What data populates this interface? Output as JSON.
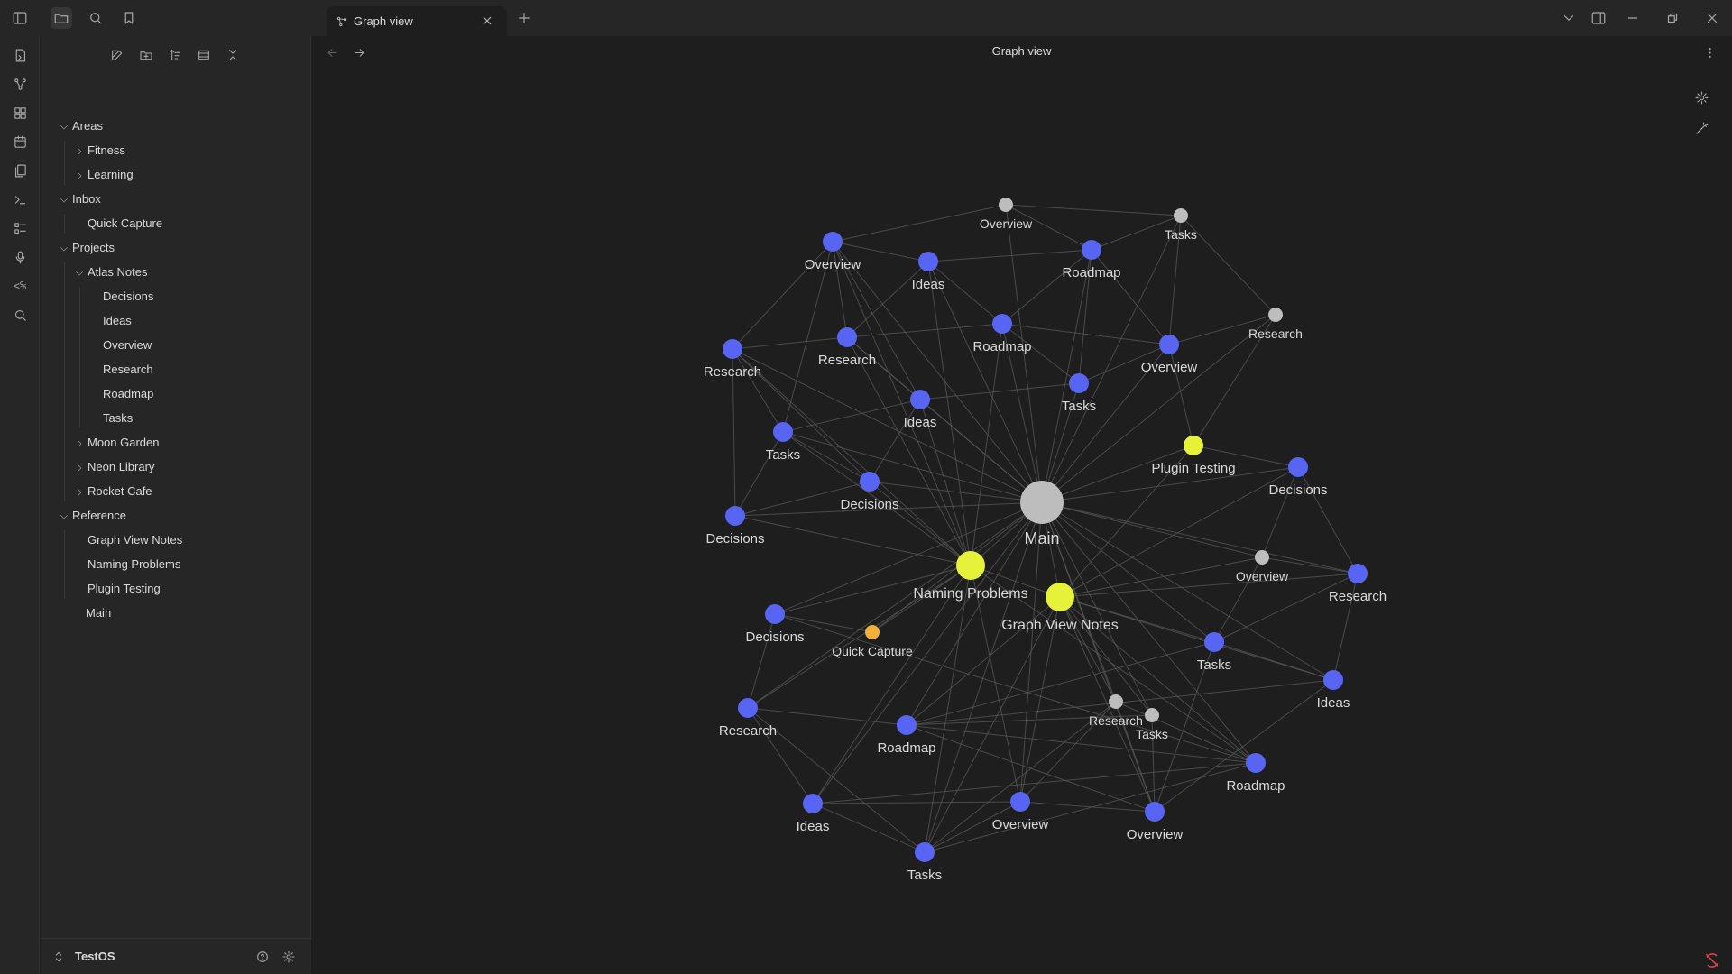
{
  "tab": {
    "title": "Graph view"
  },
  "view": {
    "title": "Graph view"
  },
  "sidebar": {
    "tree": [
      {
        "label": "Areas",
        "level": 0,
        "folder": true,
        "open": true
      },
      {
        "label": "Fitness",
        "level": 1,
        "folder": true,
        "open": false
      },
      {
        "label": "Learning",
        "level": 1,
        "folder": true,
        "open": false
      },
      {
        "label": "Inbox",
        "level": 0,
        "folder": true,
        "open": true
      },
      {
        "label": "Quick Capture",
        "level": 1,
        "folder": false
      },
      {
        "label": "Projects",
        "level": 0,
        "folder": true,
        "open": true
      },
      {
        "label": "Atlas Notes",
        "level": 1,
        "folder": true,
        "open": true
      },
      {
        "label": "Decisions",
        "level": 2,
        "folder": false
      },
      {
        "label": "Ideas",
        "level": 2,
        "folder": false
      },
      {
        "label": "Overview",
        "level": 2,
        "folder": false
      },
      {
        "label": "Research",
        "level": 2,
        "folder": false
      },
      {
        "label": "Roadmap",
        "level": 2,
        "folder": false
      },
      {
        "label": "Tasks",
        "level": 2,
        "folder": false
      },
      {
        "label": "Moon Garden",
        "level": 1,
        "folder": true,
        "open": false
      },
      {
        "label": "Neon Library",
        "level": 1,
        "folder": true,
        "open": false
      },
      {
        "label": "Rocket Cafe",
        "level": 1,
        "folder": true,
        "open": false
      },
      {
        "label": "Reference",
        "level": 0,
        "folder": true,
        "open": true
      },
      {
        "label": "Graph View Notes",
        "level": 1,
        "folder": false
      },
      {
        "label": "Naming Problems",
        "level": 1,
        "folder": false
      },
      {
        "label": "Plugin Testing",
        "level": 1,
        "folder": false
      },
      {
        "label": "Main",
        "level": 0,
        "folder": false
      }
    ]
  },
  "vault": {
    "name": "TestOS"
  },
  "colors": {
    "blue_node": "#5865f2",
    "yellow_node": "#e6f23a",
    "grey_node": "#bdbdbd",
    "orange_node": "#f2b03a",
    "edge": "#5a5a5a",
    "background": "#1e1e1e"
  },
  "graph": {
    "nodes": [
      {
        "label": "Main",
        "kind": "grey",
        "size": "xl"
      },
      {
        "label": "Naming Problems",
        "kind": "yellow",
        "size": "lg"
      },
      {
        "label": "Graph View Notes",
        "kind": "yellow",
        "size": "lg"
      },
      {
        "label": "Plugin Testing",
        "kind": "yellow",
        "size": "md"
      },
      {
        "label": "Quick Capture",
        "kind": "orange",
        "size": "sm"
      },
      {
        "label": "Overview",
        "kind": "grey",
        "size": "sm"
      },
      {
        "label": "Tasks",
        "kind": "grey",
        "size": "sm"
      },
      {
        "label": "Research",
        "kind": "grey",
        "size": "sm"
      },
      {
        "label": "Overview",
        "kind": "grey",
        "size": "sm"
      },
      {
        "label": "Research",
        "kind": "grey",
        "size": "sm"
      },
      {
        "label": "Tasks",
        "kind": "grey",
        "size": "sm"
      },
      {
        "label": "Overview",
        "kind": "blue",
        "size": "md"
      },
      {
        "label": "Ideas",
        "kind": "blue",
        "size": "md"
      },
      {
        "label": "Roadmap",
        "kind": "blue",
        "size": "md"
      },
      {
        "label": "Research",
        "kind": "blue",
        "size": "md"
      },
      {
        "label": "Research",
        "kind": "blue",
        "size": "md"
      },
      {
        "label": "Roadmap",
        "kind": "blue",
        "size": "md"
      },
      {
        "label": "Overview",
        "kind": "blue",
        "size": "md"
      },
      {
        "label": "Tasks",
        "kind": "blue",
        "size": "md"
      },
      {
        "label": "Ideas",
        "kind": "blue",
        "size": "md"
      },
      {
        "label": "Tasks",
        "kind": "blue",
        "size": "md"
      },
      {
        "label": "Decisions",
        "kind": "blue",
        "size": "md"
      },
      {
        "label": "Decisions",
        "kind": "blue",
        "size": "md"
      },
      {
        "label": "Decisions",
        "kind": "blue",
        "size": "md"
      },
      {
        "label": "Research",
        "kind": "blue",
        "size": "md"
      },
      {
        "label": "Decisions",
        "kind": "blue",
        "size": "md"
      },
      {
        "label": "Tasks",
        "kind": "blue",
        "size": "md"
      },
      {
        "label": "Ideas",
        "kind": "blue",
        "size": "md"
      },
      {
        "label": "Research",
        "kind": "blue",
        "size": "md"
      },
      {
        "label": "Roadmap",
        "kind": "blue",
        "size": "md"
      },
      {
        "label": "Roadmap",
        "kind": "blue",
        "size": "md"
      },
      {
        "label": "Ideas",
        "kind": "blue",
        "size": "md"
      },
      {
        "label": "Overview",
        "kind": "blue",
        "size": "md"
      },
      {
        "label": "Tasks",
        "kind": "blue",
        "size": "md"
      },
      {
        "label": "Overview",
        "kind": "blue",
        "size": "md"
      }
    ],
    "edges": [
      [
        0,
        1
      ],
      [
        0,
        2
      ],
      [
        0,
        3
      ],
      [
        0,
        5
      ],
      [
        0,
        6
      ],
      [
        0,
        7
      ],
      [
        0,
        11
      ],
      [
        0,
        12
      ],
      [
        0,
        13
      ],
      [
        0,
        14
      ],
      [
        0,
        15
      ],
      [
        0,
        16
      ],
      [
        0,
        17
      ],
      [
        0,
        18
      ],
      [
        0,
        19
      ],
      [
        0,
        20
      ],
      [
        0,
        21
      ],
      [
        0,
        22
      ],
      [
        0,
        23
      ],
      [
        0,
        24
      ],
      [
        0,
        25
      ],
      [
        0,
        26
      ],
      [
        0,
        27
      ],
      [
        0,
        28
      ],
      [
        0,
        29
      ],
      [
        0,
        30
      ],
      [
        0,
        31
      ],
      [
        0,
        32
      ],
      [
        0,
        33
      ],
      [
        0,
        34
      ],
      [
        0,
        8
      ],
      [
        0,
        9
      ],
      [
        0,
        10
      ],
      [
        0,
        4
      ],
      [
        1,
        2
      ],
      [
        1,
        11
      ],
      [
        1,
        12
      ],
      [
        1,
        14
      ],
      [
        1,
        15
      ],
      [
        1,
        16
      ],
      [
        1,
        19
      ],
      [
        1,
        20
      ],
      [
        1,
        21
      ],
      [
        1,
        22
      ],
      [
        1,
        25
      ],
      [
        1,
        28
      ],
      [
        1,
        30
      ],
      [
        1,
        31
      ],
      [
        1,
        32
      ],
      [
        1,
        33
      ],
      [
        1,
        4
      ],
      [
        2,
        3
      ],
      [
        2,
        8
      ],
      [
        2,
        9
      ],
      [
        2,
        10
      ],
      [
        2,
        23
      ],
      [
        2,
        24
      ],
      [
        2,
        26
      ],
      [
        2,
        27
      ],
      [
        2,
        29
      ],
      [
        2,
        30
      ],
      [
        2,
        32
      ],
      [
        2,
        33
      ],
      [
        2,
        34
      ],
      [
        5,
        6
      ],
      [
        5,
        11
      ],
      [
        5,
        13
      ],
      [
        6,
        7
      ],
      [
        6,
        13
      ],
      [
        6,
        17
      ],
      [
        7,
        17
      ],
      [
        7,
        3
      ],
      [
        11,
        12
      ],
      [
        11,
        14
      ],
      [
        11,
        15
      ],
      [
        11,
        19
      ],
      [
        11,
        20
      ],
      [
        12,
        13
      ],
      [
        12,
        15
      ],
      [
        12,
        16
      ],
      [
        13,
        16
      ],
      [
        13,
        17
      ],
      [
        13,
        18
      ],
      [
        14,
        15
      ],
      [
        14,
        20
      ],
      [
        14,
        21
      ],
      [
        14,
        22
      ],
      [
        15,
        16
      ],
      [
        15,
        19
      ],
      [
        16,
        17
      ],
      [
        16,
        18
      ],
      [
        17,
        18
      ],
      [
        17,
        3
      ],
      [
        18,
        19
      ],
      [
        19,
        20
      ],
      [
        19,
        21
      ],
      [
        20,
        21
      ],
      [
        20,
        22
      ],
      [
        21,
        22
      ],
      [
        3,
        23
      ],
      [
        23,
        8
      ],
      [
        23,
        24
      ],
      [
        8,
        24
      ],
      [
        8,
        26
      ],
      [
        24,
        27
      ],
      [
        24,
        26
      ],
      [
        26,
        27
      ],
      [
        27,
        29
      ],
      [
        26,
        29
      ],
      [
        29,
        34
      ],
      [
        26,
        34
      ],
      [
        10,
        34
      ],
      [
        10,
        29
      ],
      [
        25,
        28
      ],
      [
        25,
        4
      ],
      [
        25,
        30
      ],
      [
        28,
        31
      ],
      [
        28,
        30
      ],
      [
        28,
        33
      ],
      [
        30,
        31
      ],
      [
        30,
        33
      ],
      [
        31,
        32
      ],
      [
        31,
        33
      ],
      [
        32,
        33
      ],
      [
        32,
        9
      ],
      [
        9,
        30
      ],
      [
        9,
        33
      ],
      [
        9,
        34
      ],
      [
        32,
        34
      ],
      [
        27,
        34
      ]
    ]
  }
}
